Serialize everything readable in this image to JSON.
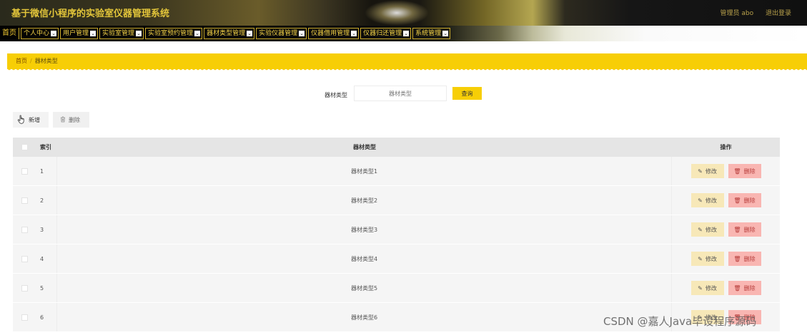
{
  "app": {
    "title": "基于微信小程序的实验室仪器管理系统",
    "user_label": "管理员 abo",
    "logout_label": "退出登录"
  },
  "nav": {
    "home_label": "首页",
    "items": [
      {
        "label": "个人中心"
      },
      {
        "label": "用户管理"
      },
      {
        "label": "实验室管理"
      },
      {
        "label": "实验室预约管理"
      },
      {
        "label": "器材类型管理"
      },
      {
        "label": "实验仪器管理"
      },
      {
        "label": "仪器借用管理"
      },
      {
        "label": "仪器归还管理"
      },
      {
        "label": "系统管理"
      }
    ]
  },
  "breadcrumb": {
    "home": "首页",
    "separator": "/",
    "current": "器材类型"
  },
  "search": {
    "label": "器材类型",
    "placeholder": "器材类型",
    "button_label": "查询"
  },
  "actions": {
    "add_label": "新增",
    "delete_label": "删除"
  },
  "table": {
    "columns": {
      "index": "索引",
      "name": "器材类型",
      "ops": "操作"
    },
    "edit_label": "修改",
    "delete_label": "删除",
    "rows": [
      {
        "index": "1",
        "name": "器材类型1"
      },
      {
        "index": "2",
        "name": "器材类型2"
      },
      {
        "index": "3",
        "name": "器材类型3"
      },
      {
        "index": "4",
        "name": "器材类型4"
      },
      {
        "index": "5",
        "name": "器材类型5"
      },
      {
        "index": "6",
        "name": "器材类型6"
      }
    ]
  },
  "watermark": "CSDN @嘉人Java毕设程序源码",
  "colors": {
    "accent": "#f7ce06",
    "edit_bg": "#f7e8b8",
    "delete_bg": "#f9b6b2"
  }
}
